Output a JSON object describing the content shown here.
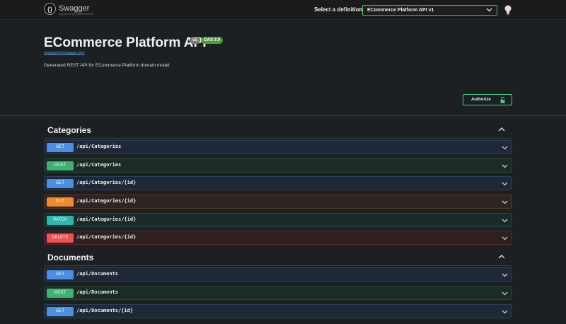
{
  "topbar": {
    "logo_text": "Swagger",
    "logo_glyph": "{}",
    "logo_sub": "supported by SMARTBEAR",
    "definition_label": "Select a definition",
    "definition_value": "ECommerce Platform API v1",
    "bulb_icon": "lightbulb-icon"
  },
  "info": {
    "title": "ECommerce Platform API",
    "version": "v1",
    "oas": "OAS 3.0",
    "spec_link": "/swagger/v1/swagger.json",
    "description": "Generated REST API for ECommerce Platform domain model"
  },
  "authorize": {
    "label": "Authorize",
    "icon": "unlock-icon"
  },
  "colors": {
    "get": "#4990e2",
    "post": "#3cb371",
    "put": "#f08a2b",
    "patch": "#2fb6ae",
    "delete": "#ef5050",
    "authorize": "#49cc90"
  },
  "tags": [
    {
      "name": "Categories",
      "operations": [
        {
          "method": "GET",
          "path": "/api/Categories"
        },
        {
          "method": "POST",
          "path": "/api/Categories"
        },
        {
          "method": "GET",
          "path": "/api/Categories/{id}"
        },
        {
          "method": "PUT",
          "path": "/api/Categories/{id}"
        },
        {
          "method": "PATCH",
          "path": "/api/Categories/{id}"
        },
        {
          "method": "DELETE",
          "path": "/api/Categories/{id}"
        }
      ]
    },
    {
      "name": "Documents",
      "operations": [
        {
          "method": "GET",
          "path": "/api/Documents"
        },
        {
          "method": "POST",
          "path": "/api/Documents"
        },
        {
          "method": "GET",
          "path": "/api/Documents/{id}"
        }
      ]
    }
  ]
}
